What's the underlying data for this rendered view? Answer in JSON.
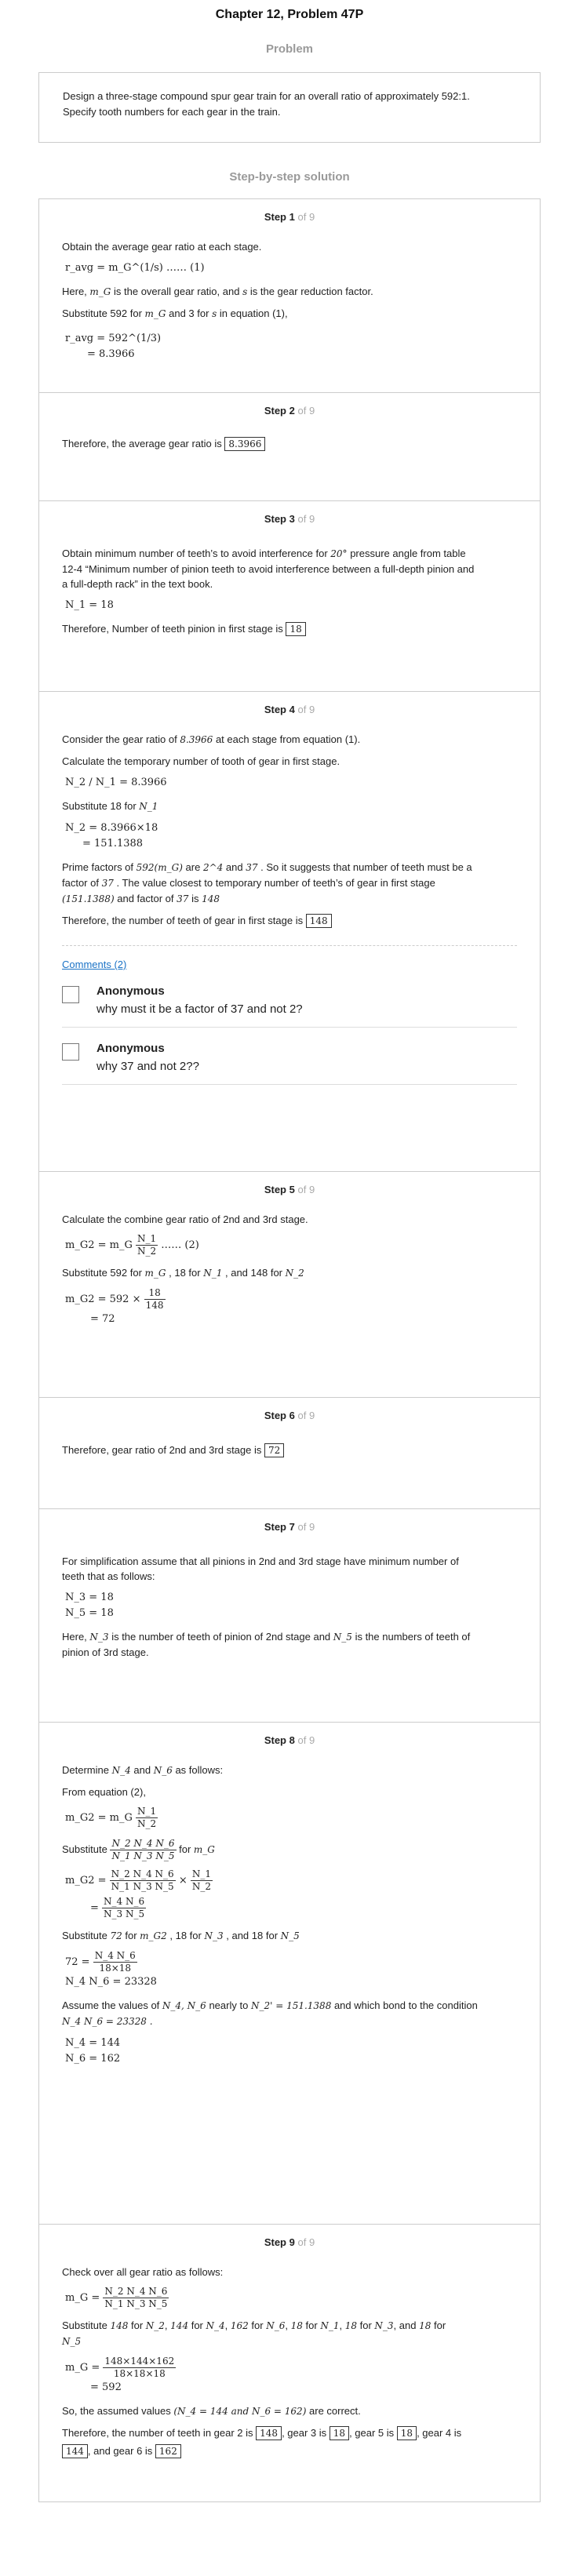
{
  "chapter_title": "Chapter 12, Problem 47P",
  "problem_heading": "Problem",
  "problem_text_1": "Design a three-stage compound spur gear train for an overall ratio of approximately 592:1.",
  "problem_text_2": "Specify tooth numbers for each gear in the train.",
  "solution_heading": "Step-by-step solution",
  "step_word": "Step",
  "of_word": "of 9",
  "steps": {
    "s1": {
      "n": "1",
      "l1": "Obtain the average gear ratio at each stage.",
      "eq1": "r_avg = m_G^(1/s) …… (1)",
      "l2a": "Here,",
      "l2b": "m_G",
      "l2c": "is the overall gear ratio, and",
      "l2d": "s",
      "l2e": "is the gear reduction factor.",
      "l3a": "Substitute 592 for",
      "l3b": "m_G",
      "l3c": "and 3 for",
      "l3d": "s",
      "l3e": "in equation (1),",
      "eq2": "r_avg = 592^(1/3)",
      "eq3": "= 8.3966"
    },
    "s2": {
      "n": "2",
      "l1": "Therefore, the average gear ratio is",
      "box": "8.3966"
    },
    "s3": {
      "n": "3",
      "l1a": "Obtain minimum number of teeth’s to avoid interference for",
      "l1b": "20°",
      "l1c": "pressure angle from table",
      "l2": "12-4 “Minimum number of pinion teeth to avoid interference between a full-depth pinion and",
      "l3": "a full-depth rack” in the text book.",
      "eq1": "N_1 = 18",
      "l4": "Therefore, Number of teeth pinion in first stage is",
      "box": "18"
    },
    "s4": {
      "n": "4",
      "l1a": "Consider the gear ratio of",
      "l1b": "8.3966",
      "l1c": "at each stage from equation (1).",
      "l2": "Calculate the temporary number of tooth of gear in first stage.",
      "eq1": "N_2 / N_1 = 8.3966",
      "l3a": "Substitute 18 for",
      "l3b": "N_1",
      "eq2": "N_2 = 8.3966×18",
      "eq3": "= 151.1388",
      "l4a": "Prime factors of",
      "l4b": "592(m_G)",
      "l4c": "are",
      "l4d": "2^4",
      "l4e": "and",
      "l4f": "37",
      "l4g": ". So it suggests that number of teeth must be a",
      "l5a": "factor of",
      "l5b": "37",
      "l5c": ". The value closest to temporary number of teeth’s of gear in first stage",
      "l6a": "(151.1388)",
      "l6b": "and factor of",
      "l6c": "37",
      "l6d": "is",
      "l6e": "148",
      "l7": "Therefore, the number of teeth of gear in first stage is",
      "box": "148",
      "comments_link": "Comments (2)",
      "comments": [
        {
          "author": "Anonymous",
          "text": "why must it be a factor of 37 and not 2?"
        },
        {
          "author": "Anonymous",
          "text": "why 37 and not 2??"
        }
      ]
    },
    "s5": {
      "n": "5",
      "l1": "Calculate the combine gear ratio of 2nd and 3rd stage.",
      "eq1a": "m_G2 = m_G",
      "eq1num": "N_1",
      "eq1den": "N_2",
      "eq1b": "…… (2)",
      "l2a": "Substitute 592 for",
      "l2b": "m_G",
      "l2c": ", 18 for",
      "l2d": "N_1",
      "l2e": ", and",
      "l2f": "148 for",
      "l2g": "N_2",
      "eq2a": "m_G2 = 592 ×",
      "eq2num": "18",
      "eq2den": "148",
      "eq3": "= 72"
    },
    "s6": {
      "n": "6",
      "l1": "Therefore, gear ratio of 2nd and 3rd stage is",
      "box": "72"
    },
    "s7": {
      "n": "7",
      "l1": "For simplification assume that all pinions in 2nd and 3rd stage have minimum number of",
      "l2": "teeth that as follows:",
      "eq1": "N_3 = 18",
      "eq2": "N_5 = 18",
      "l3a": "Here,",
      "l3b": "N_3",
      "l3c": "is the number of teeth of pinion of 2nd stage and",
      "l3d": "N_5",
      "l3e": "is the numbers of teeth of",
      "l4": "pinion of 3rd stage."
    },
    "s8": {
      "n": "8",
      "l1a": "Determine",
      "l1b": "N_4",
      "l1c": "and",
      "l1d": "N_6",
      "l1e": "as follows:",
      "l2": "From equation (2),",
      "eq1a": "m_G2 = m_G",
      "eq1num": "N_1",
      "eq1den": "N_2",
      "l3a": "Substitute",
      "l3num": "N_2 N_4 N_6",
      "l3den": "N_1 N_3 N_5",
      "l3b": "for",
      "l3c": "m_G",
      "eq2a": "m_G2 =",
      "eq2num": "N_2 N_4 N_6",
      "eq2den": "N_1 N_3 N_5",
      "eq2b": "×",
      "eq2num2": "N_1",
      "eq2den2": "N_2",
      "eq3a": "=",
      "eq3num": "N_4 N_6",
      "eq3den": "N_3 N_5",
      "l4a": "Substitute",
      "l4b": "72",
      "l4c": "for",
      "l4d": "m_G2",
      "l4e": ", 18 for",
      "l4f": "N_3",
      "l4g": ", and 18 for",
      "l4h": "N_5",
      "eq4a": "72 =",
      "eq4num": "N_4 N_6",
      "eq4den": "18×18",
      "eq5": "N_4 N_6 = 23328",
      "l5a": "Assume the values of",
      "l5b": "N_4, N_6",
      "l5c": "nearly to",
      "l5d": "N_2' = 151.1388",
      "l5e": "and which bond to the condition",
      "l6": "N_4 N_6 = 23328 .",
      "eq6": "N_4 = 144",
      "eq7": "N_6 = 162"
    },
    "s9": {
      "n": "9",
      "l1": "Check over all gear ratio as follows:",
      "eq1a": "m_G =",
      "eq1num": "N_2 N_4 N_6",
      "eq1den": "N_1 N_3 N_5",
      "l2a": "Substitute",
      "l2b": "148",
      "l2c": "for",
      "l2d": "N_2",
      "l2e": ",",
      "l2f": "144",
      "l2g": "for",
      "l2h": "N_4",
      "l2i": ",",
      "l2j": "162",
      "l2k": "for",
      "l2l": "N_6",
      "l2m": ",",
      "l2n": "18",
      "l2o": "for",
      "l2p": "N_1",
      "l2q": ",",
      "l2r": "18",
      "l2s": "for",
      "l2t": "N_3",
      "l2u": ", and",
      "l2v": "18",
      "l2w": "for",
      "l3": "N_5",
      "eq2a": "m_G =",
      "eq2num": "148×144×162",
      "eq2den": "18×18×18",
      "eq3": "= 592",
      "l4a": "So, the assumed values",
      "l4b": "(N_4 = 144 and N_6 = 162)",
      "l4c": "are correct.",
      "l5a": "Therefore, the number of teeth in gear 2 is",
      "box1": "148",
      "l5b": ", gear 3 is",
      "box2": "18",
      "l5c": ", gear 5 is",
      "box3": "18",
      "l5d": ", gear 4 is",
      "box4": "144",
      "l6a": ", and gear 6 is",
      "box5": "162"
    }
  }
}
